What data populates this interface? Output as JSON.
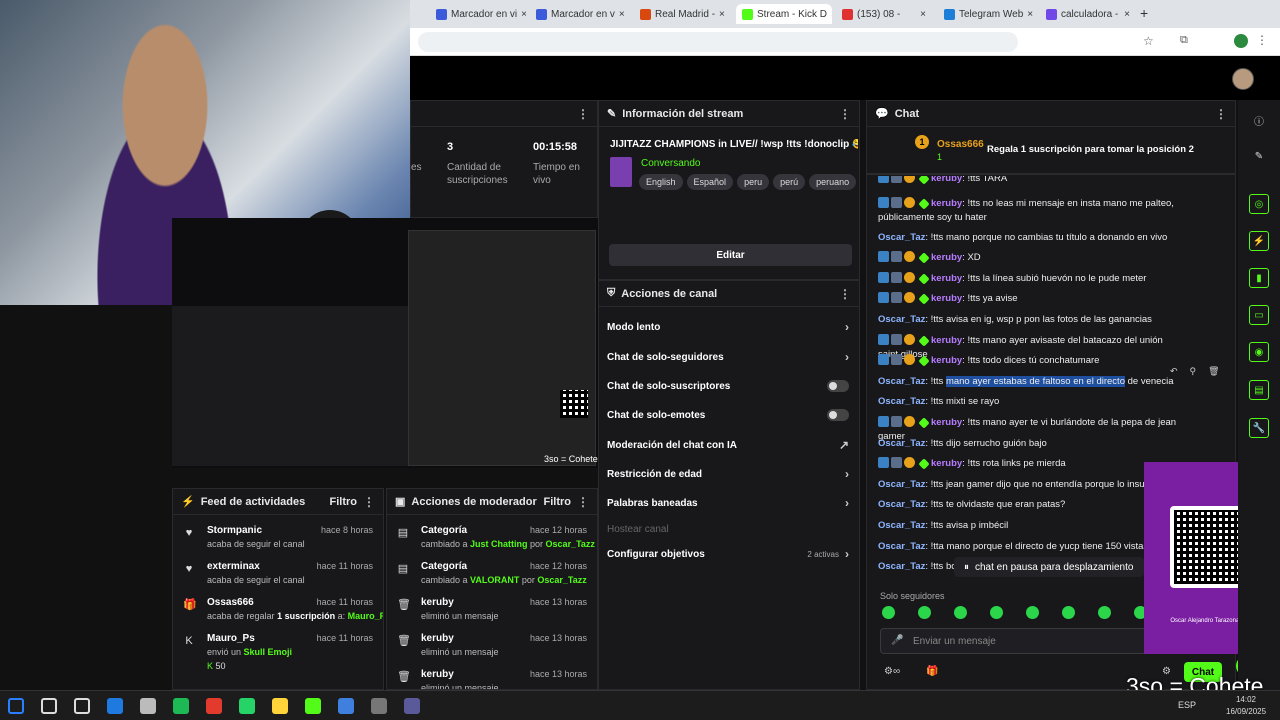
{
  "browser": {
    "tabs": [
      {
        "label": "Marcador en vi",
        "color": "#3b5bdb"
      },
      {
        "label": "Marcador en v",
        "color": "#3b5bdb"
      },
      {
        "label": "Real Madrid -",
        "color": "#d9480f"
      },
      {
        "label": "Stream - Kick D",
        "color": "#53fc18",
        "active": true
      },
      {
        "label": "(153) 08 -",
        "color": "#e03131"
      },
      {
        "label": "Telegram Web",
        "color": "#1c7ed6"
      },
      {
        "label": "calculadora -",
        "color": "#7048e8"
      }
    ]
  },
  "stats": {
    "subs_count": "3",
    "subs_label": "Cantidad de suscripciones",
    "live_time": "00:15:58",
    "live_label": "Tiempo en vivo",
    "partial_label": "es"
  },
  "stream_info": {
    "header": "Información del stream",
    "title": "JIJITAZZ CHAMPIONS in LIVE// !wsp !tts !donoclip 😂",
    "category": "Conversando",
    "tags": [
      "English",
      "Español",
      "peru",
      "perú",
      "peruano"
    ],
    "edit_label": "Editar"
  },
  "channel_actions": {
    "header": "Acciones de canal",
    "items": [
      {
        "label": "Modo lento",
        "kind": "chevron"
      },
      {
        "label": "Chat de solo-seguidores",
        "kind": "chevron"
      },
      {
        "label": "Chat de solo-suscriptores",
        "kind": "toggle"
      },
      {
        "label": "Chat de solo-emotes",
        "kind": "toggle"
      },
      {
        "label": "Moderación del chat con IA",
        "kind": "external"
      },
      {
        "label": "Restricción de edad",
        "kind": "chevron"
      },
      {
        "label": "Palabras baneadas",
        "kind": "chevron"
      },
      {
        "label": "Hostear canal",
        "kind": "disabled"
      },
      {
        "label": "Configurar objetivos",
        "kind": "chevron",
        "extra": "2 activas"
      }
    ]
  },
  "activity_feed": {
    "header": "Feed de actividades",
    "filter": "Filtro",
    "items": [
      {
        "icon": "heart-icon",
        "glyph": "♥",
        "name": "Stormpanic",
        "time": "hace 8 horas",
        "sub": "acaba de seguir el canal"
      },
      {
        "icon": "heart-icon",
        "glyph": "♥",
        "name": "exterminax",
        "time": "hace 11 horas",
        "sub": "acaba de seguir el canal"
      },
      {
        "icon": "gift-icon",
        "glyph": "🎁",
        "name": "Ossas666",
        "time": "hace 11 horas",
        "sub_pre": "acaba de regalar ",
        "sub_bold": "1 suscripción",
        "sub_mid": " a: ",
        "sub_hl": "Mauro_Ps"
      },
      {
        "icon": "kick-icon",
        "glyph": "K",
        "name": "Mauro_Ps",
        "time": "hace 11 horas",
        "sub_pre": "envió un ",
        "sub_hl": "Skull Emoji",
        "amount": "50"
      },
      {
        "icon": "kick-icon",
        "glyph": "K",
        "name": "Mauro_Ps",
        "time": "",
        "sub": ""
      }
    ]
  },
  "mod_actions": {
    "header": "Acciones de moderador",
    "filter": "Filtro",
    "items": [
      {
        "icon": "category-icon",
        "name": "Categoría",
        "time": "hace 12 horas",
        "pre": "cambiado a ",
        "hl": "Just Chatting",
        "mid": " por ",
        "hl2": "Oscar_Tazz"
      },
      {
        "icon": "category-icon",
        "name": "Categoría",
        "time": "hace 12 horas",
        "pre": "cambiado a ",
        "hl": "VALORANT",
        "mid": " por ",
        "hl2": "Oscar_Tazz"
      },
      {
        "icon": "trash-icon",
        "name": "keruby",
        "time": "hace 13 horas",
        "pre": "eliminó un mensaje"
      },
      {
        "icon": "trash-icon",
        "name": "keruby",
        "time": "hace 13 horas",
        "pre": "eliminó un mensaje"
      },
      {
        "icon": "trash-icon",
        "name": "keruby",
        "time": "hace 13 horas",
        "pre": "eliminó un mensaje"
      }
    ]
  },
  "chat": {
    "header": "Chat",
    "top_gifter": "Ossas666",
    "top_count": "1",
    "gift_cta": "Regala 1 suscripción para tomar la posición 2",
    "messages": [
      {
        "user": "keruby",
        "text": "!tts TARA",
        "badges": true
      },
      {
        "user": "keruby",
        "text": "!tts no leas mi mensaje en insta mano me palteo, públicamente soy tu hater",
        "badges": true
      },
      {
        "user": "Oscar_Taz",
        "text": "!tts mano porque no cambias tu título a donando en vivo"
      },
      {
        "user": "keruby",
        "text": "XD",
        "badges": true
      },
      {
        "user": "keruby",
        "text": "!tts la línea subió huevón no le pude meter",
        "badges": true
      },
      {
        "user": "keruby",
        "text": "!tts ya avise",
        "badges": true
      },
      {
        "user": "Oscar_Taz",
        "text": "!tts avisa en ig, wsp p pon las fotos de las ganancias"
      },
      {
        "user": "keruby",
        "text": "!tts mano ayer avisaste del batacazo del unión saint gillose",
        "badges": true
      },
      {
        "user": "keruby",
        "text": "!tts todo dices tú conchatumare",
        "badges": true
      },
      {
        "user": "Oscar_Taz",
        "text": "!tts mano ayer estabas de faltoso en el directo de venecia",
        "selected": "mano ayer estabas de faltoso en el directo"
      },
      {
        "user": "Oscar_Taz",
        "text": "!tts mixti se rayo"
      },
      {
        "user": "keruby",
        "text": "!tts mano ayer te vi burlándote de la pepa de jean gamer",
        "badges": true
      },
      {
        "user": "Oscar_Taz",
        "text": "!tts dijo serrucho guión bajo"
      },
      {
        "user": "keruby",
        "text": "!tts rota links pe mierda",
        "badges": true
      },
      {
        "user": "Oscar_Taz",
        "text": "!tts jean gamer dijo que no entendía porque lo insulta"
      },
      {
        "user": "Oscar_Taz",
        "text": "!tts te olvidaste que eran patas?"
      },
      {
        "user": "Oscar_Taz",
        "text": "!tts avisa p imbécil"
      },
      {
        "user": "Oscar_Taz",
        "text": "!tta mano porque el directo de yucp tiene 150 vistas y"
      },
      {
        "user": "Oscar_Taz",
        "text": "!tts bot"
      }
    ],
    "paused": "chat en pausa para desplazamiento",
    "followers_only": "Solo seguidores",
    "input_placeholder": "Enviar un mensaje",
    "chat_button": "Chat"
  },
  "qr_overlay": {
    "caption": "Oscar Alejandro Tarazona Veliz"
  },
  "watermark": "3so = Cohete",
  "preview_watermark": "3so = Cohete",
  "clock": {
    "time": "14:02",
    "date": "16/09/2025",
    "lang": "ESP"
  }
}
